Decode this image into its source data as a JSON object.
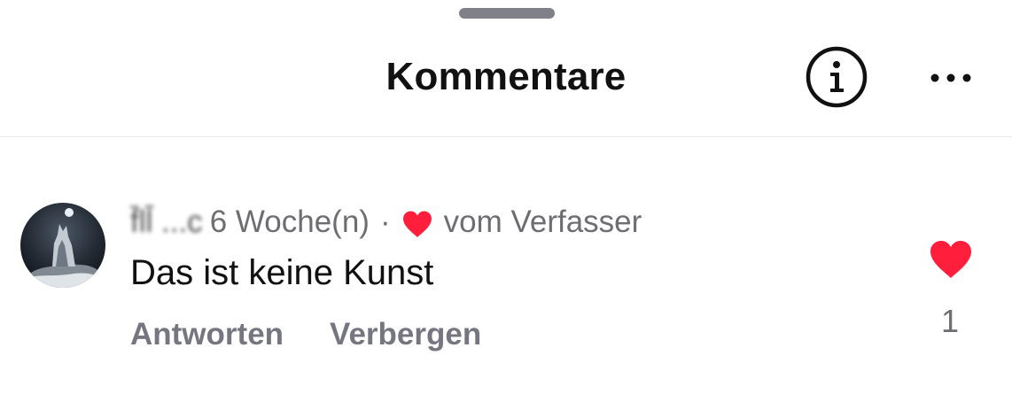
{
  "sheet": {
    "title": "Kommentare",
    "info_icon": "info-circle-icon",
    "more_icon": "ellipsis-icon"
  },
  "comment": {
    "username": "f̄ll̄ ...c",
    "age": "6 Woche(n)",
    "separator": "·",
    "author_like_label": "vom Verfasser",
    "text": "Das ist keine Kunst",
    "reply_label": "Antworten",
    "hide_label": "Verbergen",
    "like_count": "1",
    "like_icon": "heart-filled-icon",
    "author_heart_icon": "heart-filled-icon"
  },
  "colors": {
    "heart": "#ff1f3d",
    "secondary_text": "#6d6d72",
    "action_text": "#767680",
    "grabber": "#80808a"
  }
}
